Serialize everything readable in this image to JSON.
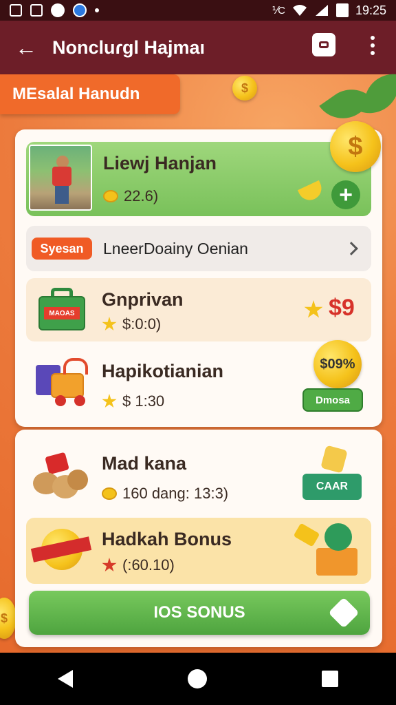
{
  "status_bar": {
    "time": "19:25",
    "extra": "⅟C"
  },
  "app_bar": {
    "title": "Noncluɾgl Hajmaı",
    "back_icon": "back-arrow-icon",
    "bag_icon": "shopping-bag-icon",
    "more_icon": "more-vert-icon"
  },
  "section_tag": "MEsalal Hanudn",
  "card1": {
    "profile": {
      "name": "Liewj Hanjan",
      "value": "22.6)"
    },
    "banner": {
      "pill": "Syesan",
      "text": "LneerDoainy Oenian"
    },
    "item1": {
      "title": "Gnprivan",
      "value": "$:0:0)",
      "price": "$9",
      "box_label": "MAOAS"
    },
    "item2": {
      "title": "Hapikotianian",
      "value": "$ 1:30",
      "coin_label": "$09%",
      "button": "Dmosa"
    }
  },
  "card2": {
    "item1": {
      "title": "Mad kana",
      "value": "160 dang: 13:3)",
      "button": "CAAR"
    },
    "item2": {
      "title": "Hadkah Bonus",
      "value": "(:60.10)"
    },
    "bonus_button": "IOS SONUS"
  },
  "colors": {
    "appbar": "#6d1e28",
    "accent": "#f06a2a",
    "green": "#4fab45",
    "background": "#e9733a"
  }
}
